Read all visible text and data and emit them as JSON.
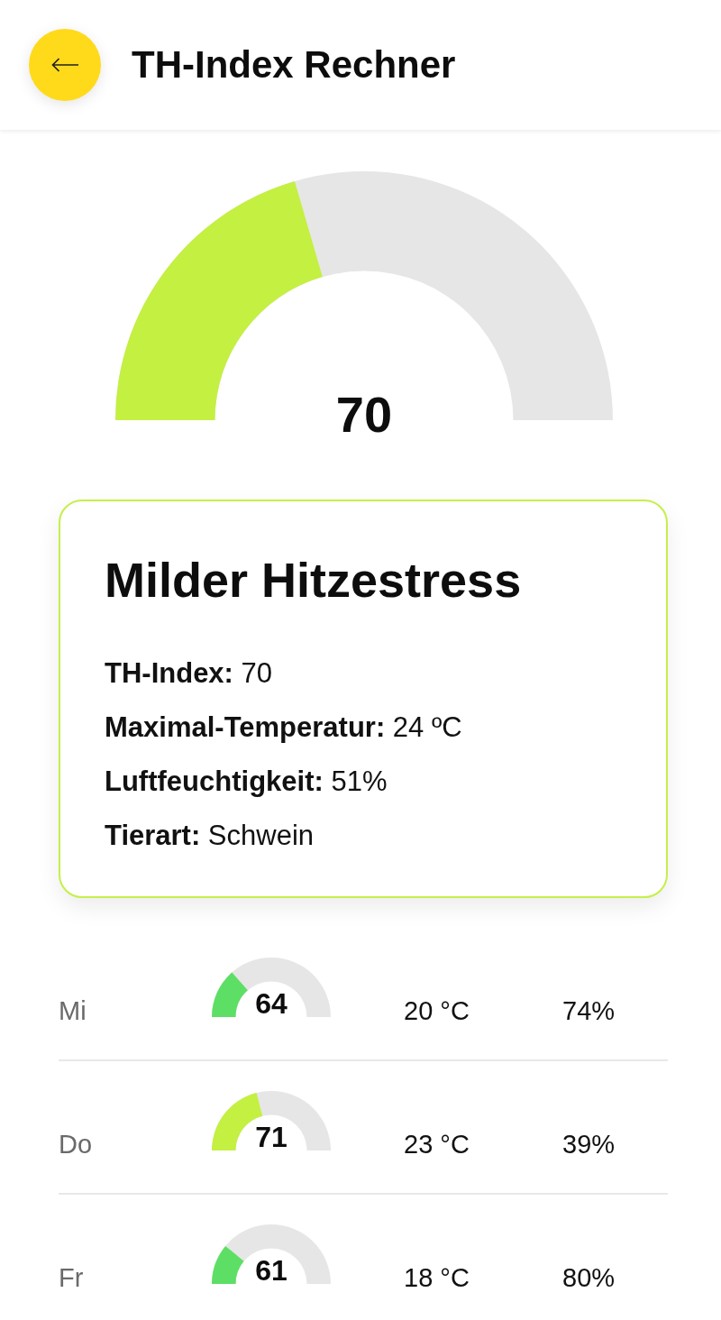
{
  "header": {
    "title": "TH-Index Rechner"
  },
  "gauge": {
    "level": 0.41,
    "value": "70"
  },
  "result": {
    "title": "Milder Hitzestress",
    "details": [
      "**TH-Index:** 70",
      "**Maximal-Temperatur:** 24 ºC",
      "**Luftfeuchtigkeit:** 51%",
      "**Tierart:** Schwein"
    ]
  },
  "forecast": [
    {
      "day": "Mi",
      "level": 0.27,
      "color": "#5ddf66",
      "index": "64",
      "temperature": "20 °C",
      "humidity": "74%"
    },
    {
      "day": "Do",
      "level": 0.42,
      "color": "#c4f042",
      "index": "71",
      "temperature": "23 °C",
      "humidity": "39%"
    },
    {
      "day": "Fr",
      "level": 0.22,
      "color": "#5ddf66",
      "index": "61",
      "temperature": "18 °C",
      "humidity": "80%"
    }
  ]
}
